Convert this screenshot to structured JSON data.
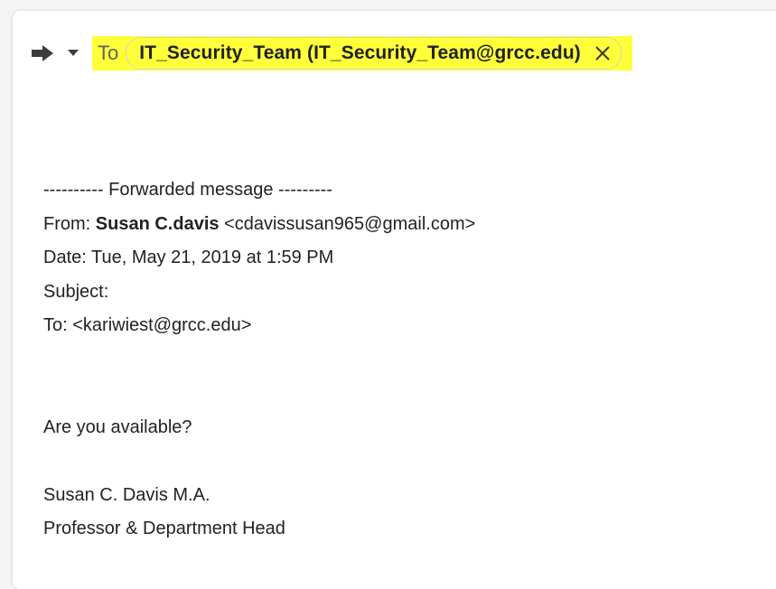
{
  "compose": {
    "to_label": "To",
    "recipient_chip": "IT_Security_Team (IT_Security_Team@grcc.edu)"
  },
  "forward": {
    "separator": "---------- Forwarded message ---------",
    "from_label": "From: ",
    "from_name": "Susan C.davis",
    "from_email": " <cdavissusan965@gmail.com>",
    "date_line": "Date: Tue, May 21, 2019 at 1:59 PM",
    "subject_line": "Subject:",
    "to_line": "To: <kariwiest@grcc.edu>"
  },
  "message": {
    "body": "Are you available?",
    "signature_name": "Susan C. Davis M.A.",
    "signature_title": "Professor & Department Head"
  },
  "colors": {
    "highlight": "#ffff3a",
    "text": "#222222"
  },
  "icons": [
    "forward-arrow-icon",
    "chevron-down-icon",
    "close-icon"
  ]
}
